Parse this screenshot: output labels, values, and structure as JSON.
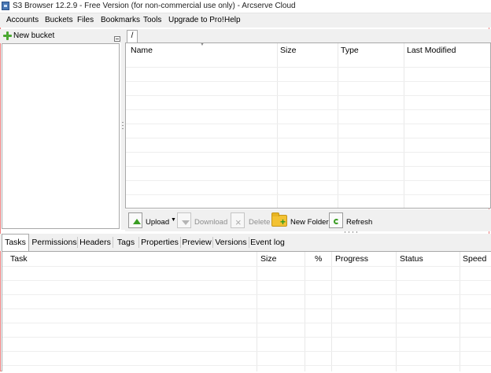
{
  "window": {
    "title": "S3 Browser 12.2.9 - Free Version (for non-commercial use only) - Arcserve Cloud",
    "icon": "s3-browser-app-icon"
  },
  "menu": {
    "items": [
      "Accounts",
      "Buckets",
      "Files",
      "Bookmarks",
      "Tools",
      "Upgrade to Pro!",
      "Help"
    ]
  },
  "left_panel": {
    "new_bucket_label": "New bucket",
    "new_bucket_icon": "plus-icon"
  },
  "file_panel": {
    "path": "/",
    "columns": [
      "Name",
      "Size",
      "Type",
      "Last Modified"
    ],
    "rows": []
  },
  "file_toolbar": {
    "upload_label": "Upload",
    "download_label": "Download",
    "delete_label": "Delete",
    "new_folder_label": "New Folder",
    "refresh_label": "Refresh"
  },
  "bottom_tabs": [
    "Tasks",
    "Permissions",
    "Headers",
    "Tags",
    "Properties",
    "Preview",
    "Versions",
    "Event log"
  ],
  "active_bottom_tab": "Tasks",
  "tasks_panel": {
    "columns": [
      "Task",
      "Size",
      "%",
      "Progress",
      "Status",
      "Speed"
    ],
    "rows": []
  }
}
